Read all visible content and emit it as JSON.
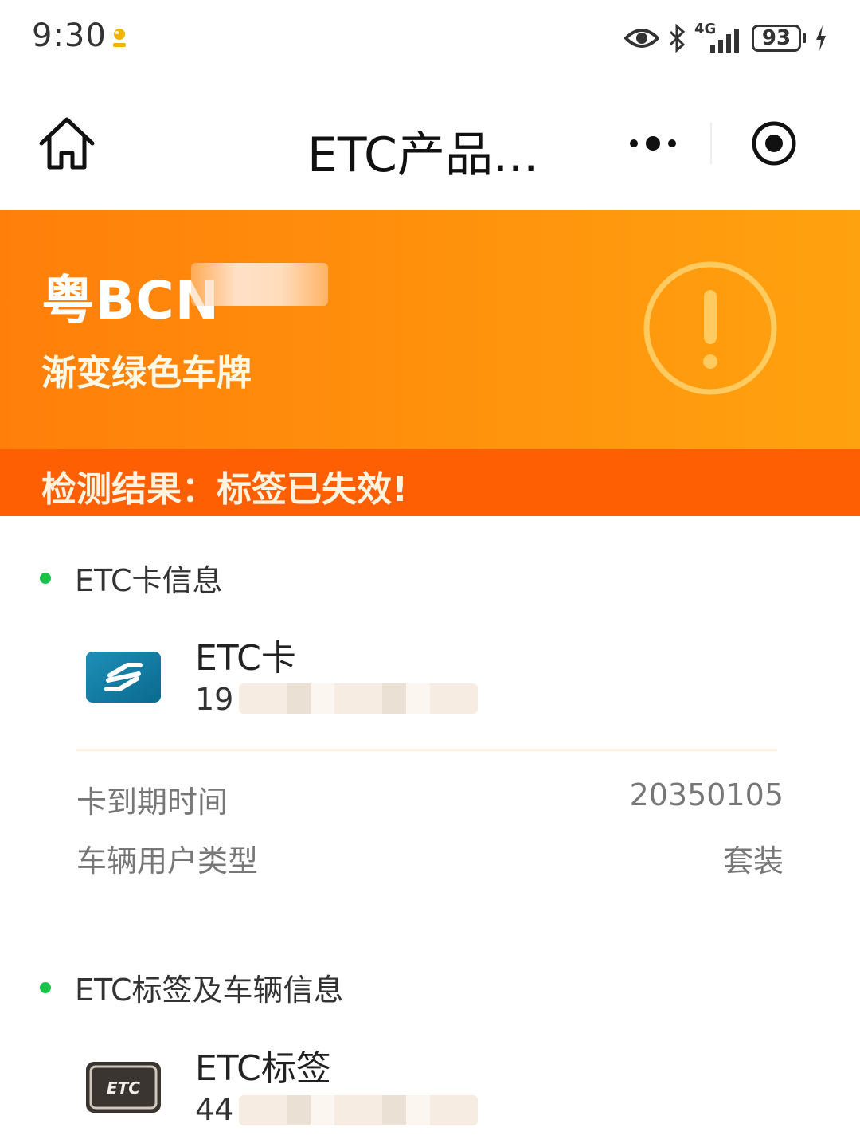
{
  "status_bar": {
    "time": "9:30",
    "network": "4G",
    "battery": "93"
  },
  "nav": {
    "title": "ETC产品..."
  },
  "banner": {
    "plate": "粤BCN",
    "plate_type": "渐变绿色车牌",
    "result": "检测结果：标签已失效!"
  },
  "etc_card": {
    "section_title": "ETC卡信息",
    "name": "ETC卡",
    "number": "19",
    "rows": [
      {
        "label": "卡到期时间",
        "value": "20350105"
      },
      {
        "label": "车辆用户类型",
        "value": "套装"
      }
    ]
  },
  "etc_tag": {
    "section_title": "ETC标签及车辆信息",
    "name": "ETC标签",
    "icon_text": "ETC",
    "number": "44"
  },
  "colors": {
    "banner_start": "#ff7f0a",
    "banner_end": "#ffa20f",
    "result_bar": "#ff5f03",
    "section_dot": "#19c34a"
  }
}
